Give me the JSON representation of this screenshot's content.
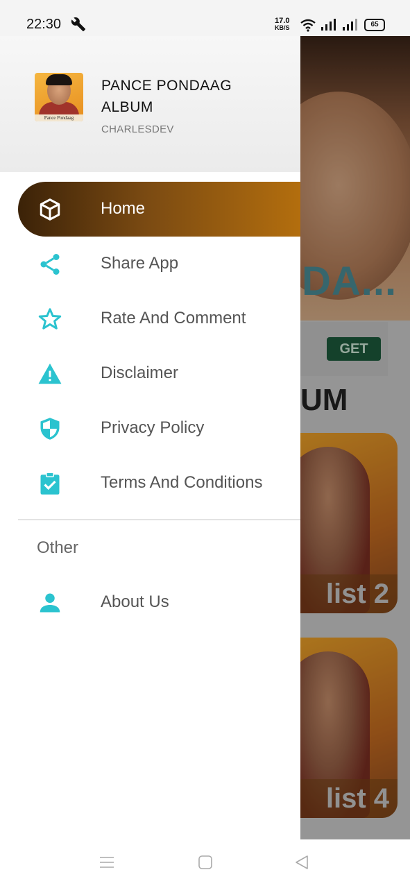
{
  "status_bar": {
    "time": "22:30",
    "speed_value": "17.0",
    "speed_unit": "KB/S",
    "battery": "65",
    "icons": [
      "wrench-icon",
      "wifi-icon",
      "signal-icon",
      "signal-icon",
      "battery-icon"
    ]
  },
  "drawer": {
    "app_name": "PANCE PONDAAG ALBUM",
    "developer": "CHARLESDEV",
    "avatar_caption": "Pance Pondaag",
    "items": [
      {
        "label": "Home",
        "icon": "cube-icon",
        "active": true
      },
      {
        "label": "Share App",
        "icon": "share-icon"
      },
      {
        "label": "Rate And Comment",
        "icon": "star-icon"
      },
      {
        "label": "Disclaimer",
        "icon": "warning-icon"
      },
      {
        "label": "Privacy Policy",
        "icon": "shield-icon"
      },
      {
        "label": "Terms And Conditions",
        "icon": "clipboard-check-icon"
      }
    ],
    "other_section": "Other",
    "other_items": [
      {
        "label": "About Us",
        "icon": "person-icon"
      }
    ]
  },
  "background": {
    "hero_title_fragment": "DA...",
    "ad_button": "GET",
    "section_title_fragment": "UM",
    "cards": [
      {
        "label_fragment": "list 2"
      },
      {
        "label_fragment": "list 4"
      }
    ]
  },
  "colors": {
    "accent_icon": "#2bc3cf",
    "active_gradient_start": "#3b2208",
    "active_gradient_end": "#b36e0e",
    "ad_button": "#1d5a3c"
  },
  "nav_bar": {
    "icons": [
      "menu-icon",
      "home-square-icon",
      "back-triangle-icon"
    ]
  }
}
